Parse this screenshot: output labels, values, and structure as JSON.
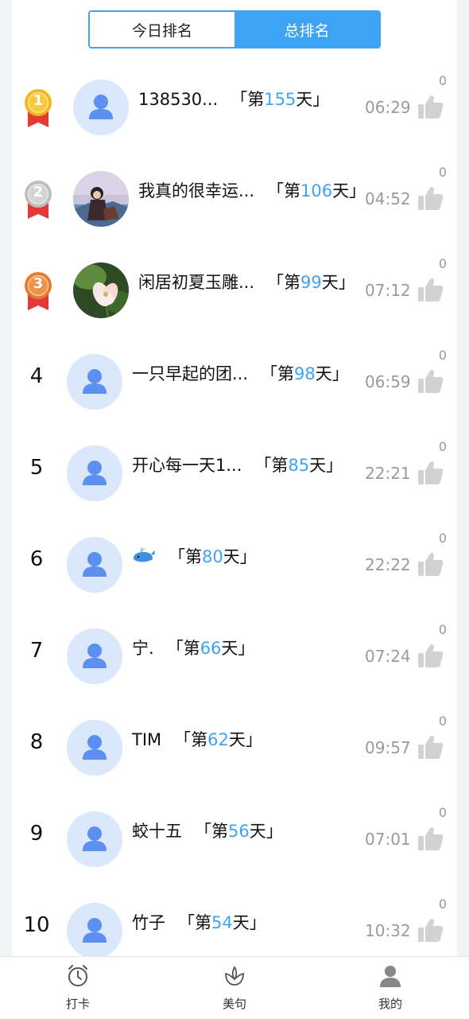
{
  "tabs": {
    "today": "今日排名",
    "total": "总排名",
    "active": "total"
  },
  "rows": [
    {
      "rank": "1",
      "medal": "gold",
      "name": "138530...",
      "day_prefix": "「第",
      "days": "155",
      "day_suffix": "天」",
      "time": "06:29",
      "likes": "0",
      "avatar": "default-avatar"
    },
    {
      "rank": "2",
      "medal": "silver",
      "name": "我真的很幸运...",
      "day_prefix": "「第",
      "days": "106",
      "day_suffix": "天」",
      "time": "04:52",
      "likes": "0",
      "avatar": "photo-avatar-girl"
    },
    {
      "rank": "3",
      "medal": "bronze",
      "name": "闲居初夏玉雕...",
      "day_prefix": "「第",
      "days": "99",
      "day_suffix": "天」",
      "time": "07:12",
      "likes": "0",
      "avatar": "photo-avatar-flower"
    },
    {
      "rank": "4",
      "name": "一只早起的团...",
      "day_prefix": "「第",
      "days": "98",
      "day_suffix": "天」",
      "time": "06:59",
      "likes": "0",
      "avatar": "default-avatar"
    },
    {
      "rank": "5",
      "name": "开心每一天1...",
      "day_prefix": "「第",
      "days": "85",
      "day_suffix": "天」",
      "time": "22:21",
      "likes": "0",
      "avatar": "default-avatar"
    },
    {
      "rank": "6",
      "name": "",
      "name_icon": "whale-emoji-icon",
      "day_prefix": "「第",
      "days": "80",
      "day_suffix": "天」",
      "time": "22:22",
      "likes": "0",
      "avatar": "default-avatar"
    },
    {
      "rank": "7",
      "name": "宁.",
      "day_prefix": "「第",
      "days": "66",
      "day_suffix": "天」",
      "time": "07:24",
      "likes": "0",
      "avatar": "default-avatar"
    },
    {
      "rank": "8",
      "name": "TIM",
      "day_prefix": "「第",
      "days": "62",
      "day_suffix": "天」",
      "time": "09:57",
      "likes": "0",
      "avatar": "default-avatar"
    },
    {
      "rank": "9",
      "name": "蛟十五",
      "day_prefix": "「第",
      "days": "56",
      "day_suffix": "天」",
      "time": "07:01",
      "likes": "0",
      "avatar": "default-avatar"
    },
    {
      "rank": "10",
      "name": "竹子",
      "day_prefix": "「第",
      "days": "54",
      "day_suffix": "天」",
      "time": "10:32",
      "likes": "0",
      "avatar": "default-avatar"
    }
  ],
  "nav": [
    {
      "label": "打卡",
      "icon": "alarm-clock-icon"
    },
    {
      "label": "美句",
      "icon": "lotus-icon"
    },
    {
      "label": "我的",
      "icon": "user-icon"
    }
  ],
  "colors": {
    "accent": "#3ea3f5",
    "avatar_bg": "#dbe7fb",
    "avatar_fg": "#5b8ff0",
    "gold": "#f4b41a",
    "silver": "#c9c9c9",
    "bronze": "#e8833a",
    "ribbon": "#e53935"
  }
}
